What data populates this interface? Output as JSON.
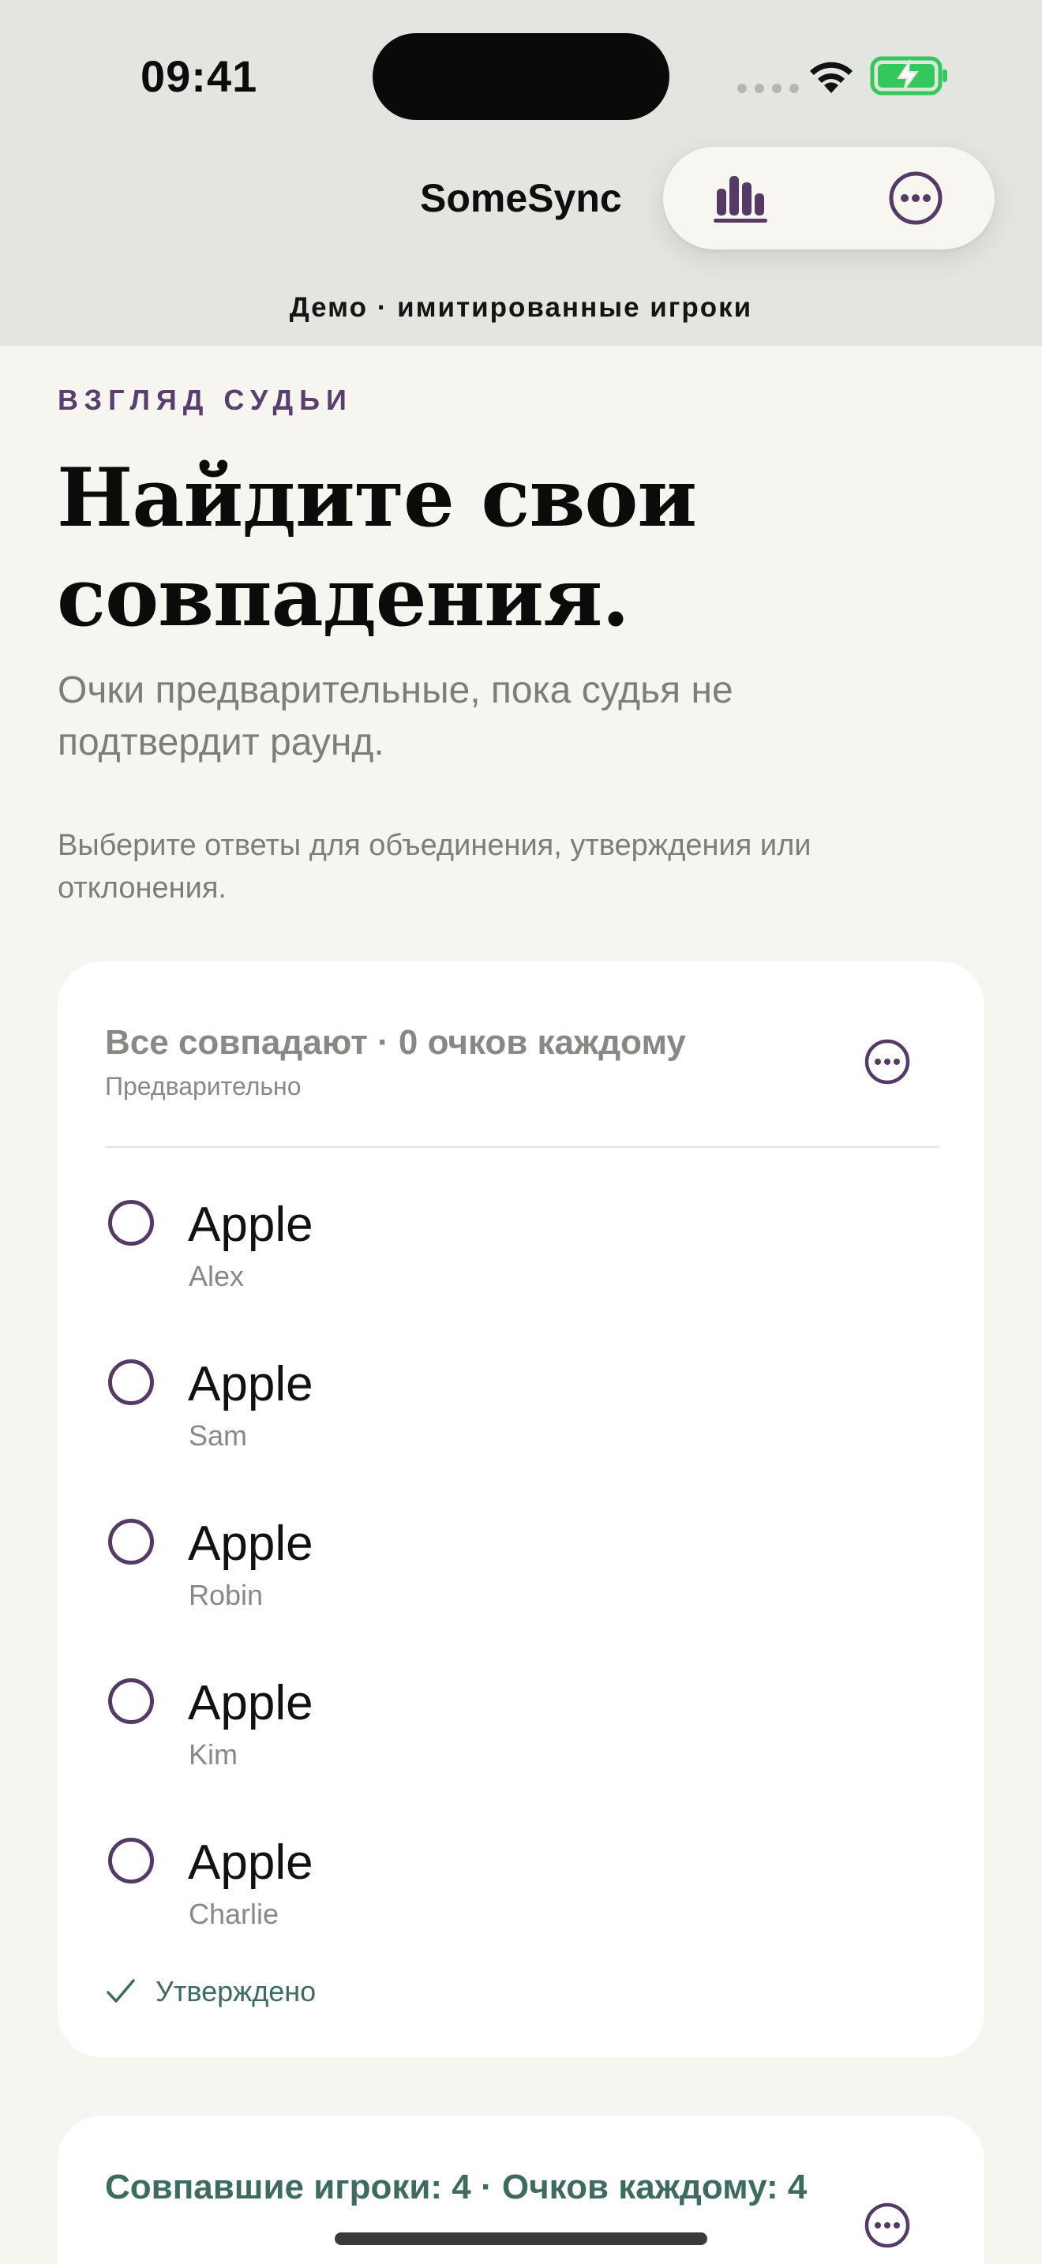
{
  "status_bar": {
    "time": "09:41"
  },
  "header": {
    "app_title": "SomeSync",
    "stats_icon": "bar-chart-icon",
    "more_icon": "ellipsis-circle-icon",
    "demo_banner": "Демо · имитированные игроки"
  },
  "intro": {
    "eyebrow": "ВЗГЛЯД СУДЬИ",
    "headline": "Найдите свои совпадения.",
    "subtitle": "Очки предварительные, пока судья не подтвердит раунд.",
    "hint": "Выберите ответы для объединения, утверждения или отклонения."
  },
  "group_card": {
    "title": "Все совпадают · 0 очков каждому",
    "status": "Предварительно",
    "answers": [
      {
        "word": "Apple",
        "player": "Alex"
      },
      {
        "word": "Apple",
        "player": "Sam"
      },
      {
        "word": "Apple",
        "player": "Robin"
      },
      {
        "word": "Apple",
        "player": "Kim"
      },
      {
        "word": "Apple",
        "player": "Charlie"
      }
    ],
    "approved_label": "Утверждено"
  },
  "match_card": {
    "title": "Совпавшие игроки: 4 · Очков каждому: 4"
  },
  "colors": {
    "accent_purple": "#553a66",
    "accent_green": "#3d6b62",
    "background": "#f7f5ef",
    "chrome": "#e2e5e0",
    "battery_green": "#34c759"
  }
}
